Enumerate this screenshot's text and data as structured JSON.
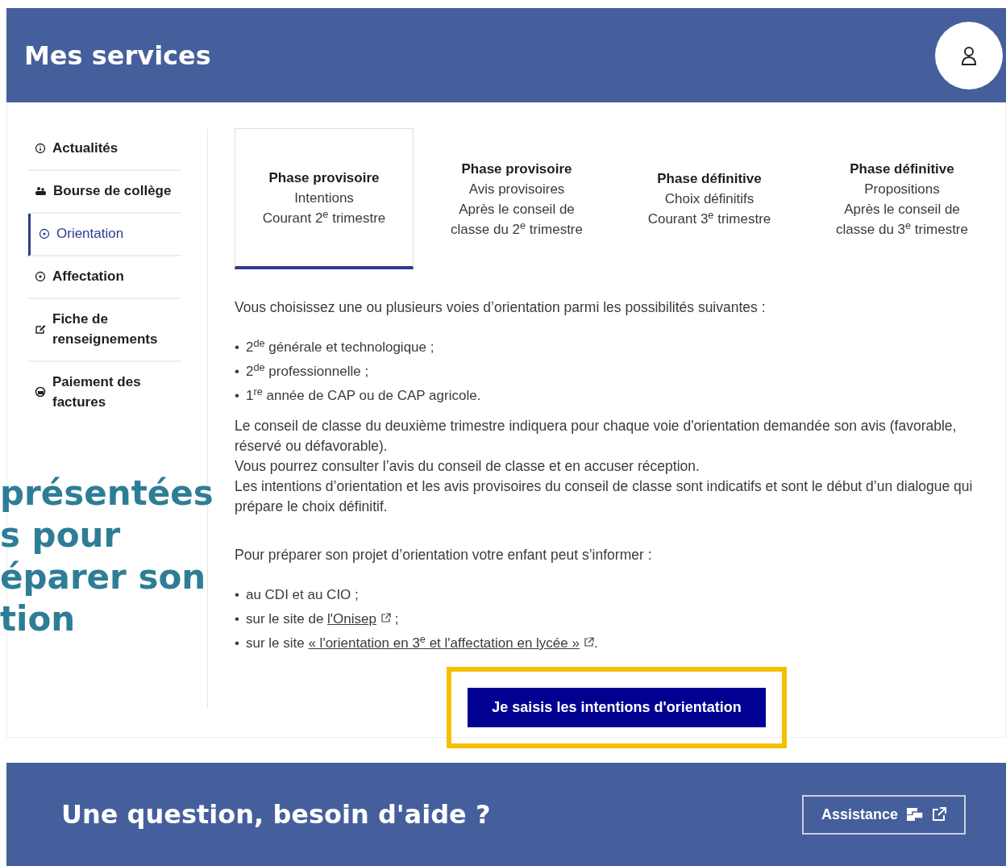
{
  "header": {
    "title": "Mes services"
  },
  "sidebar": {
    "items": [
      {
        "label": "Actualités",
        "selected": false
      },
      {
        "label": "Bourse de collège",
        "selected": false
      },
      {
        "label": "Orientation",
        "selected": true
      },
      {
        "label": "Affectation",
        "selected": false
      },
      {
        "label": "Fiche de renseignements",
        "selected": false
      },
      {
        "label": "Paiement des factures",
        "selected": false
      }
    ]
  },
  "tabs": [
    {
      "title": "Phase provisoire",
      "lines": [
        "Intentions",
        "Courant 2$^{e}$ trimestre"
      ],
      "selected": true
    },
    {
      "title": "Phase provisoire",
      "lines": [
        "Avis provisoires",
        "Après le conseil de classe du 2$^{e}$ trimestre"
      ],
      "selected": false
    },
    {
      "title": "Phase définitive",
      "lines": [
        "Choix définitifs",
        "Courant 3$^{e}$ trimestre"
      ],
      "selected": false
    },
    {
      "title": "Phase définitive",
      "lines": [
        "Propositions",
        "Après le conseil de classe du 3$^{e}$ trimestre"
      ],
      "selected": false
    }
  ],
  "content": {
    "intro": "Vous choisissez une ou plusieurs voies d’orientation parmi les possibilités suivantes :",
    "options": [
      "2$^{de}$ générale et technologique ;",
      "2$^{de}$ professionnelle ;",
      "1$^{re}$ année de CAP ou de CAP agricole."
    ],
    "paragraphs": [
      "Le conseil de classe du deuxième trimestre indiquera pour chaque voie d'orientation demandée son avis (favorable, réservé ou défavorable).",
      "Vous pourrez consulter l’avis du conseil de classe et en accuser réception.",
      "Les intentions d’orientation et les avis provisoires du conseil de classe sont indicatifs et sont le début d’un dialogue qui prépare le choix définitif."
    ],
    "info_intro": "Pour préparer son projet d’orientation votre enfant peut s’informer :",
    "resources": [
      {
        "text": "au CDI et au CIO ;"
      },
      {
        "text": "sur le site de",
        "link": "l'Onisep",
        "after": ";"
      },
      {
        "text": "sur le site",
        "link": "« l'orientation en 3$^{e}$ et l'affectation en lycée »",
        "after": "."
      }
    ],
    "bullet": "•",
    "cta_button": {
      "label": "Je saisis les intentions d'orientation",
      "highlighted": true
    }
  },
  "overlay_text": [
    "présentées",
    "s pour",
    "éparer son",
    "tion"
  ],
  "footer": {
    "title": "Une question, besoin d'aide ?",
    "button": "Assistance"
  }
}
